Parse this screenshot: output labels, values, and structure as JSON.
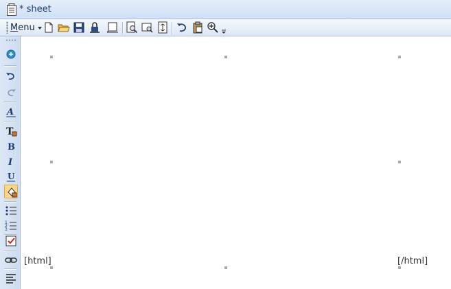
{
  "window": {
    "title": "* sheet",
    "icon": "document-icon"
  },
  "toolbar": {
    "menu_prefix": "M",
    "menu_rest": "enu",
    "buttons": [
      {
        "name": "new-document-button",
        "icon": "new-page-icon"
      },
      {
        "name": "open-folder-button",
        "icon": "folder-open-icon"
      },
      {
        "name": "save-button",
        "icon": "floppy-disk-icon"
      },
      {
        "name": "lock-button",
        "icon": "lock-icon"
      },
      {
        "name": "page-setup-button",
        "icon": "page-setup-icon"
      },
      {
        "name": "print-preview-button",
        "icon": "print-preview-icon"
      },
      {
        "name": "find-button",
        "icon": "find-icon"
      },
      {
        "name": "fit-page-button",
        "icon": "fit-page-icon"
      },
      {
        "name": "undo-button",
        "icon": "undo-icon"
      },
      {
        "name": "paste-button",
        "icon": "clipboard-icon"
      },
      {
        "name": "zoom-button",
        "icon": "zoom-in-icon"
      }
    ]
  },
  "sidebar": {
    "tools": [
      "add-circle-icon",
      "undo-icon",
      "redo-icon",
      "text-style-icon",
      "text-color-icon",
      "bold-icon",
      "italic-icon",
      "underline-icon",
      "fill-color-icon",
      "bullet-list-icon",
      "numbered-list-icon",
      "checkbox-icon",
      "link-icon",
      "align-left-icon"
    ],
    "active_tool": "fill-color-icon"
  },
  "canvas": {
    "open_tag": "[html]",
    "close_tag": "[/html]"
  },
  "colors": {
    "titlebar": "#cfe0f5",
    "toolbar": "#dce7f5",
    "active_tool": "#ffd88a",
    "handle": "#a9a9a9"
  }
}
